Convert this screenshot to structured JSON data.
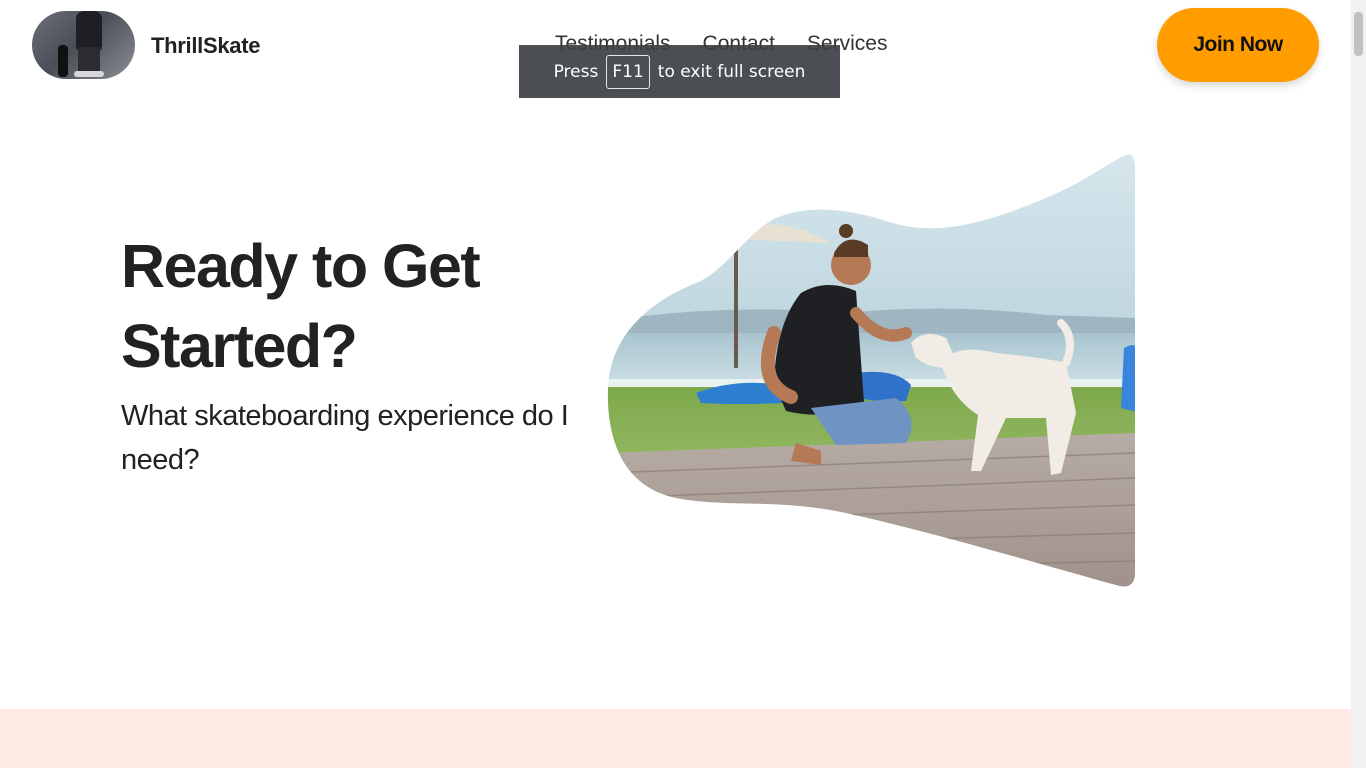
{
  "header": {
    "brand": "ThrillSkate",
    "nav": [
      "Testimonials",
      "Contact",
      "Services"
    ],
    "cta_label": "Join Now"
  },
  "fullscreen_toast": {
    "prefix": "Press",
    "key": "F11",
    "suffix": "to exit full screen"
  },
  "hero": {
    "title": "Ready to Get Started?",
    "subtitle": "What skateboarding experience do I need?"
  },
  "colors": {
    "accent": "#ff9d00",
    "peach_band": "#fdebe4",
    "text": "#222222"
  }
}
